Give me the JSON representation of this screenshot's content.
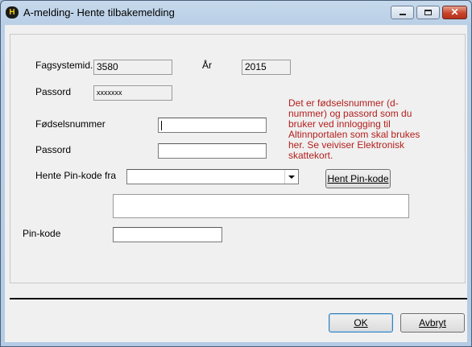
{
  "window": {
    "title": "A-melding- Hente tilbakemelding",
    "app_icon_glyph": "H",
    "min_glyph": "",
    "max_glyph": "",
    "close_glyph": "✕"
  },
  "form": {
    "fagsystemid_label": "Fagsystemid.",
    "fagsystemid_value": "3580",
    "aar_label": "År",
    "aar_value": "2015",
    "passord1_label": "Passord",
    "passord1_value": "xxxxxxx",
    "fodselsnummer_label": "Fødselsnummer",
    "fodselsnummer_value": "",
    "passord2_label": "Passord",
    "passord2_value": "",
    "hente_pin_label": "Hente Pin-kode fra",
    "hente_pin_selected": "",
    "hent_pin_button": "Hent Pin-kode",
    "message_value": "",
    "pin_label": "Pin-kode",
    "pin_value": "",
    "info_text": "Det er fødselsnummer (d-nummer) og passord som du bruker ved innlogging til Altinnportalen som skal brukes her. Se veiviser Elektronisk skattekort."
  },
  "buttons": {
    "ok": "OK",
    "cancel": "Avbryt"
  },
  "colors": {
    "info_text": "#b3201e",
    "client_bg": "#f0f0f0",
    "frame": "#b9cfe6"
  }
}
